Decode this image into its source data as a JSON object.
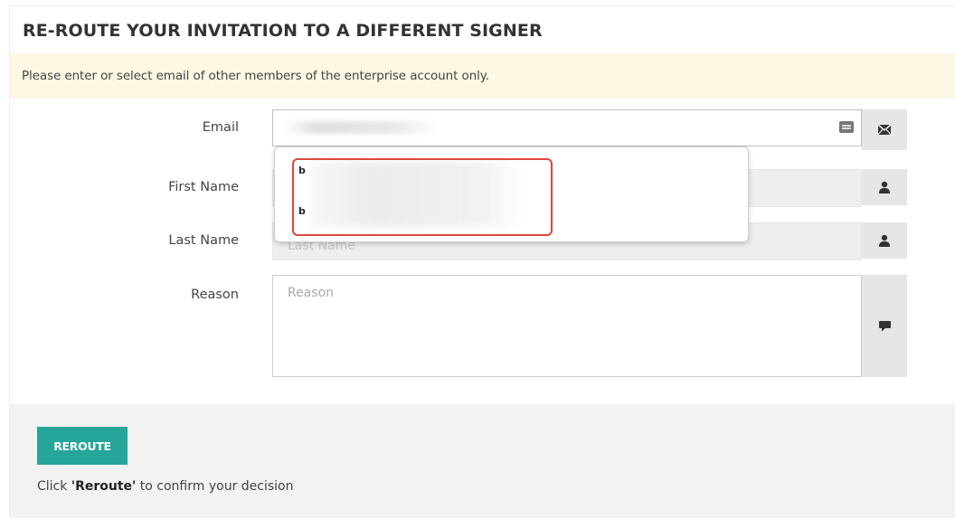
{
  "title": "RE-ROUTE YOUR INVITATION TO A DIFFERENT SIGNER",
  "notice": "Please enter or select email of other members of the enterprise account only.",
  "form": {
    "email_label": "Email",
    "first_name_label": "First Name",
    "last_name_label": "Last Name",
    "last_name_placeholder": "Last Name",
    "reason_label": "Reason",
    "reason_placeholder": "Reason"
  },
  "autocomplete": {
    "items": [
      {
        "label": "b"
      },
      {
        "label": "b"
      }
    ]
  },
  "footer": {
    "button_label": "REROUTE",
    "hint_prefix": "Click ",
    "hint_strong": "'Reroute'",
    "hint_suffix": " to confirm your decision"
  },
  "icons": {
    "email_addon": "envelope-icon",
    "first_name_addon": "user-icon",
    "last_name_addon": "user-icon",
    "reason_addon": "comment-icon",
    "autofill": "autofill-card-icon"
  },
  "colors": {
    "accent": "#26a69a",
    "notice_bg": "#fcf8e3",
    "highlight": "#e0453d"
  }
}
